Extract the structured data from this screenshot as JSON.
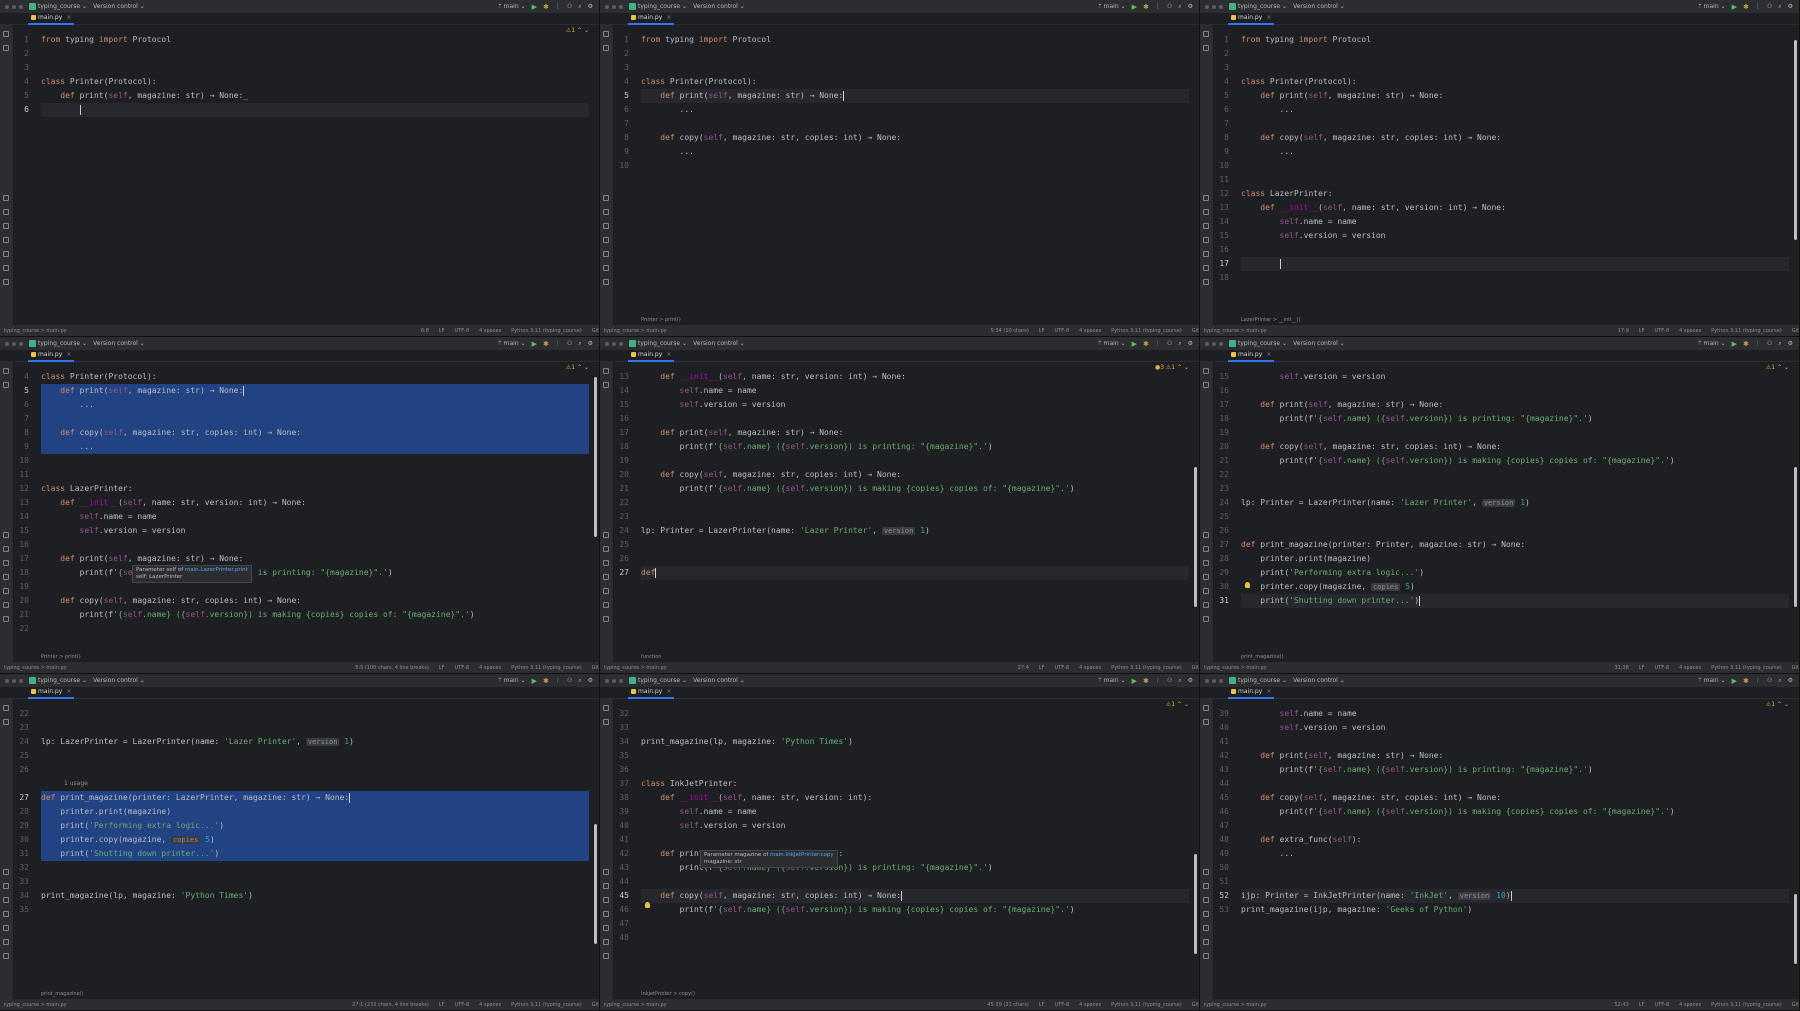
{
  "common": {
    "project": "typing_course",
    "vcs": "Version control",
    "branch": "main",
    "file_tab": "main.py",
    "status_crumb": "typing_course > main.py",
    "encoding": "UTF-8",
    "line_sep": "LF",
    "indent": "4 spaces",
    "interpreter": "Python 3.11 (typing_course)",
    "lock": "Git"
  },
  "panes": [
    {
      "cursor_pos": "6:8",
      "breadcrumb": "",
      "warning": "⚠1",
      "lines": [
        {
          "n": "1",
          "t": "from typing import Protocol"
        },
        {
          "n": "2",
          "t": ""
        },
        {
          "n": "3",
          "t": ""
        },
        {
          "n": "4",
          "t": "class Printer(Protocol):"
        },
        {
          "n": "5",
          "t": "    def print(self, magazine: str) → None:_"
        },
        {
          "n": "6",
          "t": "        "
        }
      ]
    },
    {
      "cursor_pos": "5:34 (10 chars)",
      "breadcrumb": "Printer > print()",
      "warning": "",
      "lines": [
        {
          "n": "1",
          "t": "from typing import Protocol"
        },
        {
          "n": "2",
          "t": ""
        },
        {
          "n": "3",
          "t": ""
        },
        {
          "n": "4",
          "t": "class Printer(Protocol):"
        },
        {
          "n": "5",
          "t": "    def print(self, magazine: str) → None:"
        },
        {
          "n": "6",
          "t": "        ..."
        },
        {
          "n": "7",
          "t": ""
        },
        {
          "n": "8",
          "t": "    def copy(self, magazine: str, copies: int) → None:"
        },
        {
          "n": "9",
          "t": "        ..."
        },
        {
          "n": "10",
          "t": ""
        }
      ]
    },
    {
      "cursor_pos": "17:9",
      "breadcrumb": "LazerPrinter > __init__()",
      "warning": "",
      "lines": [
        {
          "n": "1",
          "t": "from typing import Protocol"
        },
        {
          "n": "2",
          "t": ""
        },
        {
          "n": "3",
          "t": ""
        },
        {
          "n": "4",
          "t": "class Printer(Protocol):"
        },
        {
          "n": "5",
          "t": "    def print(self, magazine: str) → None:"
        },
        {
          "n": "6",
          "t": "        ..."
        },
        {
          "n": "7",
          "t": ""
        },
        {
          "n": "8",
          "t": "    def copy(self, magazine: str, copies: int) → None:"
        },
        {
          "n": "9",
          "t": "        ..."
        },
        {
          "n": "10",
          "t": ""
        },
        {
          "n": "11",
          "t": ""
        },
        {
          "n": "12",
          "t": "class LazerPrinter:"
        },
        {
          "n": "13",
          "t": "    def __init__(self, name: str, version: int) → None:"
        },
        {
          "n": "14",
          "t": "        self.name = name"
        },
        {
          "n": "15",
          "t": "        self.version = version"
        },
        {
          "n": "16",
          "t": ""
        },
        {
          "n": "17",
          "t": "        "
        },
        {
          "n": "18",
          "t": ""
        }
      ]
    },
    {
      "cursor_pos": "5:5 (100 chars, 4 line breaks)",
      "breadcrumb": "Printer > print()",
      "warning": "⚠1",
      "popup": {
        "title": "Parameter self of",
        "link": "main.LazerPrinter.print",
        "sub": "self: LazerPrinter"
      },
      "lines": [
        {
          "n": "4",
          "t": "class Printer(Protocol):"
        },
        {
          "n": "5",
          "t": "    def print(self, magazine: str) → None:"
        },
        {
          "n": "6",
          "t": "        ..."
        },
        {
          "n": "7",
          "t": ""
        },
        {
          "n": "8",
          "t": "    def copy(self, magazine: str, copies: int) → None:"
        },
        {
          "n": "9",
          "t": "        ..."
        },
        {
          "n": "10",
          "t": ""
        },
        {
          "n": "11",
          "t": ""
        },
        {
          "n": "12",
          "t": "class LazerPrinter:"
        },
        {
          "n": "13",
          "t": "    def __init__(self, name: str, version: int) → None:"
        },
        {
          "n": "14",
          "t": "        self.name = name"
        },
        {
          "n": "15",
          "t": "        self.version = version"
        },
        {
          "n": "16",
          "t": ""
        },
        {
          "n": "17",
          "t": "    def print(self, magazine: str) → None:"
        },
        {
          "n": "18",
          "t": "        print(f'{self.name} ({self.version}) is printing: \"{magazine}\".')"
        },
        {
          "n": "19",
          "t": ""
        },
        {
          "n": "20",
          "t": "    def copy(self, magazine: str, copies: int) → None:"
        },
        {
          "n": "21",
          "t": "        print(f'{self.name} ({self.version}) is making {copies} copies of: \"{magazine}\".')"
        },
        {
          "n": "22",
          "t": ""
        }
      ]
    },
    {
      "cursor_pos": "27:4",
      "breadcrumb": "function",
      "warning": "●3 ⚠1",
      "lines": [
        {
          "n": "13",
          "t": "    def __init__(self, name: str, version: int) → None:"
        },
        {
          "n": "14",
          "t": "        self.name = name"
        },
        {
          "n": "15",
          "t": "        self.version = version"
        },
        {
          "n": "16",
          "t": ""
        },
        {
          "n": "17",
          "t": "    def print(self, magazine: str) → None:"
        },
        {
          "n": "18",
          "t": "        print(f'{self.name} ({self.version}) is printing: \"{magazine}\".')"
        },
        {
          "n": "19",
          "t": ""
        },
        {
          "n": "20",
          "t": "    def copy(self, magazine: str, copies: int) → None:"
        },
        {
          "n": "21",
          "t": "        print(f'{self.name} ({self.version}) is making {copies} copies of: \"{magazine}\".')"
        },
        {
          "n": "22",
          "t": ""
        },
        {
          "n": "23",
          "t": ""
        },
        {
          "n": "24",
          "t": "lp: Printer = LazerPrinter(name: 'Lazer Printer', version: 1)"
        },
        {
          "n": "25",
          "t": ""
        },
        {
          "n": "26",
          "t": ""
        },
        {
          "n": "27",
          "t": "def"
        }
      ]
    },
    {
      "cursor_pos": "31:38",
      "breadcrumb": "print_magazine()",
      "warning": "⚠1",
      "lines": [
        {
          "n": "15",
          "t": "        self.version = version"
        },
        {
          "n": "16",
          "t": ""
        },
        {
          "n": "17",
          "t": "    def print(self, magazine: str) → None:"
        },
        {
          "n": "18",
          "t": "        print(f'{self.name} ({self.version}) is printing: \"{magazine}\".')"
        },
        {
          "n": "19",
          "t": ""
        },
        {
          "n": "20",
          "t": "    def copy(self, magazine: str, copies: int) → None:"
        },
        {
          "n": "21",
          "t": "        print(f'{self.name} ({self.version}) is making {copies} copies of: \"{magazine}\".')"
        },
        {
          "n": "22",
          "t": ""
        },
        {
          "n": "23",
          "t": ""
        },
        {
          "n": "24",
          "t": "lp: Printer = LazerPrinter(name: 'Lazer Printer', version: 1)"
        },
        {
          "n": "25",
          "t": ""
        },
        {
          "n": "26",
          "t": ""
        },
        {
          "n": "27",
          "t": "def print_magazine(printer: Printer, magazine: str) → None:"
        },
        {
          "n": "28",
          "t": "    printer.print(magazine)"
        },
        {
          "n": "29",
          "t": "    print('Performing extra logic...')"
        },
        {
          "n": "30",
          "t": "    printer.copy(magazine, copies: 5)"
        },
        {
          "n": "31",
          "t": "    print('Shutting down printer...')"
        }
      ]
    },
    {
      "cursor_pos": "27:1 (233 chars, 4 line breaks)",
      "breadcrumb": "print_magazine()",
      "warning": "",
      "usage": "1 usage",
      "lines": [
        {
          "n": "22",
          "t": ""
        },
        {
          "n": "23",
          "t": ""
        },
        {
          "n": "24",
          "t": "lp: LazerPrinter = LazerPrinter(name: 'Lazer Printer', version: 1)"
        },
        {
          "n": "25",
          "t": ""
        },
        {
          "n": "26",
          "t": ""
        },
        {
          "n": "",
          "t": ""
        },
        {
          "n": "27",
          "t": "def print_magazine(printer: LazerPrinter, magazine: str) → None:"
        },
        {
          "n": "28",
          "t": "    printer.print(magazine)"
        },
        {
          "n": "29",
          "t": "    print('Performing extra logic...')"
        },
        {
          "n": "30",
          "t": "    printer.copy(magazine, copies: 5)"
        },
        {
          "n": "31",
          "t": "    print('Shutting down printer...')"
        },
        {
          "n": "32",
          "t": ""
        },
        {
          "n": "33",
          "t": ""
        },
        {
          "n": "34",
          "t": "print_magazine(lp, magazine: 'Python Times')"
        },
        {
          "n": "35",
          "t": ""
        }
      ]
    },
    {
      "cursor_pos": "45:39 (21 chars)",
      "breadcrumb": "InkJetPrinter > copy()",
      "warning": "⚠1",
      "popup": {
        "title": "Parameter magazine of",
        "link": "main.InkJetPrinter.copy",
        "sub": "magazine: str"
      },
      "lines": [
        {
          "n": "32",
          "t": ""
        },
        {
          "n": "33",
          "t": ""
        },
        {
          "n": "34",
          "t": "print_magazine(lp, magazine: 'Python Times')"
        },
        {
          "n": "35",
          "t": ""
        },
        {
          "n": "36",
          "t": ""
        },
        {
          "n": "37",
          "t": "class InkJetPrinter:"
        },
        {
          "n": "38",
          "t": "    def __init__(self, name: str, version: int):"
        },
        {
          "n": "39",
          "t": "        self.name = name"
        },
        {
          "n": "40",
          "t": "        self.version = version"
        },
        {
          "n": "41",
          "t": ""
        },
        {
          "n": "42",
          "t": "    def print(self, magazine: str) → None:"
        },
        {
          "n": "43",
          "t": "        print(f'{self.name} ({self.version}) is printing: \"{magazine}\".')"
        },
        {
          "n": "44",
          "t": ""
        },
        {
          "n": "45",
          "t": "    def copy(self, magazine: str, copies: int) → None:"
        },
        {
          "n": "46",
          "t": "        print(f'{self.name} ({self.version}) is making {copies} copies of: \"{magazine}\".')"
        },
        {
          "n": "47",
          "t": ""
        },
        {
          "n": "48",
          "t": ""
        }
      ]
    },
    {
      "cursor_pos": "52:43",
      "breadcrumb": "",
      "warning": "⚠1",
      "lines": [
        {
          "n": "39",
          "t": "        self.name = name"
        },
        {
          "n": "40",
          "t": "        self.version = version"
        },
        {
          "n": "41",
          "t": ""
        },
        {
          "n": "42",
          "t": "    def print(self, magazine: str) → None:"
        },
        {
          "n": "43",
          "t": "        print(f'{self.name} ({self.version}) is printing: \"{magazine}\".')"
        },
        {
          "n": "44",
          "t": ""
        },
        {
          "n": "45",
          "t": "    def copy(self, magazine: str, copies: int) → None:"
        },
        {
          "n": "46",
          "t": "        print(f'{self.name} ({self.version}) is making {copies} copies of: \"{magazine}\".')"
        },
        {
          "n": "47",
          "t": ""
        },
        {
          "n": "48",
          "t": "    def extra_func(self):"
        },
        {
          "n": "49",
          "t": "        ..."
        },
        {
          "n": "50",
          "t": ""
        },
        {
          "n": "51",
          "t": ""
        },
        {
          "n": "52",
          "t": "ijp: Printer = InkJetPrinter(name: 'InkJet', version: 10)"
        },
        {
          "n": "53",
          "t": "print_magazine(ijp, magazine: 'Geeks of Python')"
        }
      ]
    }
  ]
}
